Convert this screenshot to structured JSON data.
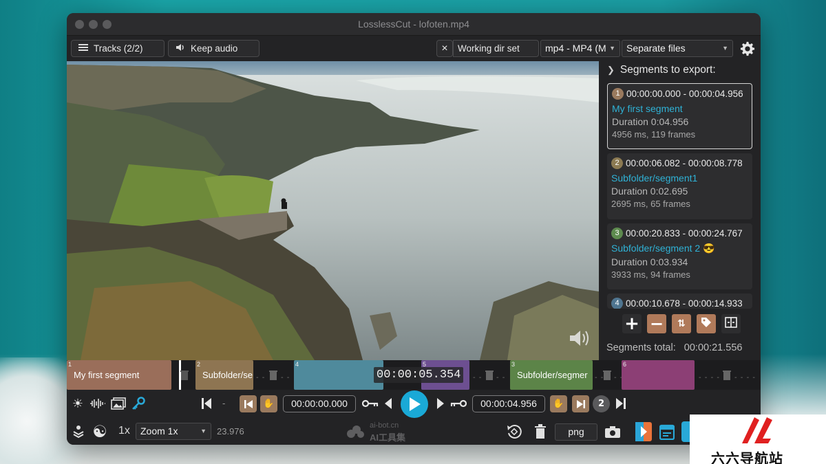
{
  "window": {
    "title": "LosslessCut - lofoten.mp4"
  },
  "toolbar": {
    "tracks_label": "Tracks (2/2)",
    "keep_audio_label": "Keep audio",
    "close_label": "×",
    "working_dir_label": "Working dir set",
    "format_value": "mp4 - MP4 (M",
    "output_mode_value": "Separate files"
  },
  "segments_panel": {
    "header": "Segments to export:",
    "segments": [
      {
        "num": "1",
        "range": "00:00:00.000 - 00:00:04.956",
        "name": "My first segment",
        "duration": "Duration 0:04.956",
        "info": "4956 ms, 119 frames",
        "color": "#9a7a5e"
      },
      {
        "num": "2",
        "range": "00:00:06.082 - 00:00:08.778",
        "name": "Subfolder/segment1",
        "duration": "Duration 0:02.695",
        "info": "2695 ms, 65 frames",
        "color": "#8c7a52"
      },
      {
        "num": "3",
        "range": "00:00:20.833 - 00:00:24.767",
        "name": "Subfolder/segment 2 😎",
        "duration": "Duration 0:03.934",
        "info": "3933 ms, 94 frames",
        "color": "#5d8a4e"
      },
      {
        "num": "4",
        "range": "00:00:10.678 - 00:00:14.933",
        "color": "#4f7590"
      }
    ],
    "total_label": "Segments total:",
    "total_value": "00:00:21.556"
  },
  "timeline": {
    "segments": [
      {
        "idx": "1",
        "label": "My first segment",
        "color": "#9a6e5a"
      },
      {
        "idx": "2",
        "label": "Subfolder/se",
        "color": "#8e7552"
      },
      {
        "idx": "4",
        "label": "",
        "color": "#4f8a9c"
      },
      {
        "idx": "5",
        "label": "",
        "color": "#6d4f91"
      },
      {
        "idx": "3",
        "label": "Subfolder/segmer",
        "color": "#5c8448"
      },
      {
        "idx": "6",
        "label": "",
        "color": "#8c3f75"
      }
    ],
    "current_time": "00:00:05.354"
  },
  "controls": {
    "start_time": "00:00:00.000",
    "end_time": "00:00:04.956",
    "segment_number": "2",
    "playback_rate": "1x",
    "zoom_value": "Zoom 1x",
    "fps": "23.976",
    "capture_format": "png",
    "dash": "-"
  },
  "watermark": {
    "line1": "ai-bot.cn",
    "line2": "AI工具集"
  },
  "brand": {
    "text": "六六导航站",
    "color": "#e02020"
  }
}
